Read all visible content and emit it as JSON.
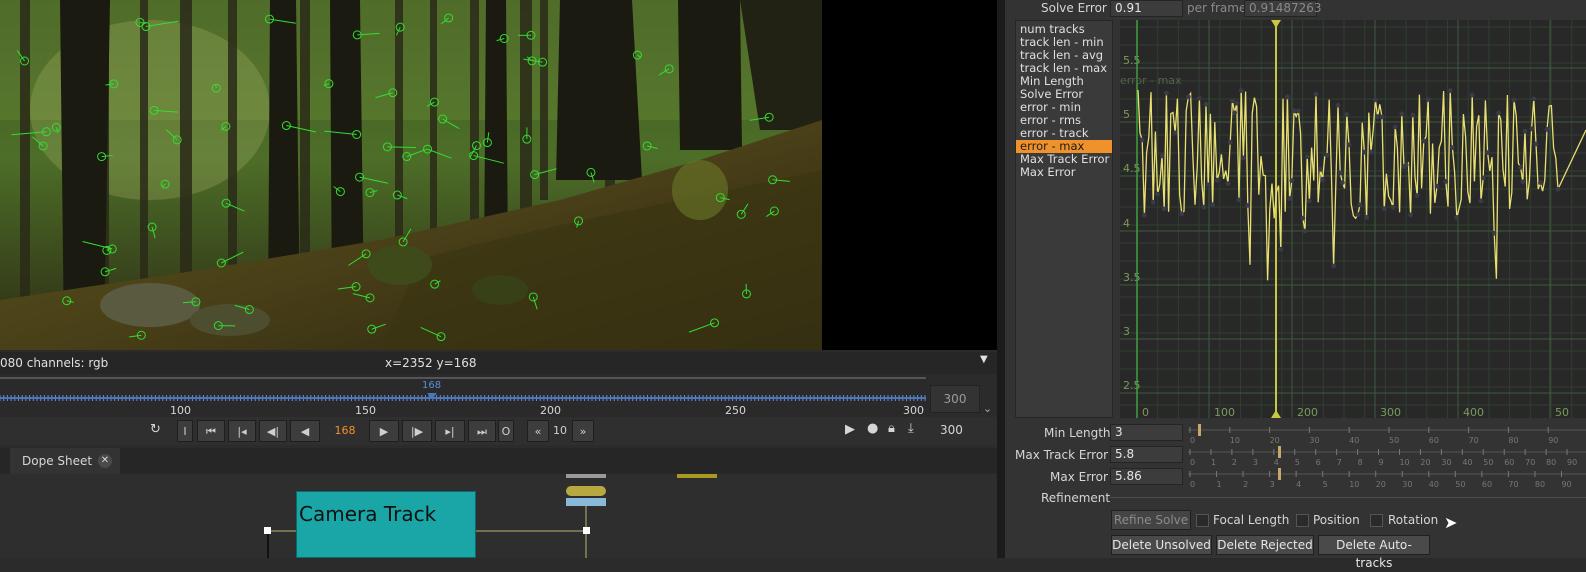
{
  "viewer": {
    "info_format": "080 channels: rgb",
    "coords": "x=2352 y=168"
  },
  "timeline": {
    "current_frame_marker": "168",
    "ticks": [
      "100",
      "150",
      "200",
      "250",
      "300"
    ],
    "end_frame": "300"
  },
  "transport": {
    "frame_field": "168",
    "increment": "10",
    "end_frame": "300",
    "in_label": "I",
    "out_label": "O"
  },
  "dopesheet": {
    "tab_label": "Dope Sheet",
    "node_label": "Camera Track"
  },
  "solve": {
    "error_label": "Solve Error",
    "error_value": "0.91",
    "per_frame_label": "per frame",
    "per_frame_value": "0.91487263"
  },
  "list_items": [
    "num tracks",
    "track len - min",
    "track len - avg",
    "track len - max",
    "Min Length",
    "Solve Error",
    "error - min",
    "error - rms",
    "error - track",
    "error - max",
    "Max Track Error",
    "Max Error"
  ],
  "selected_item": "error - max",
  "graph": {
    "curve_label": "error - max",
    "y_ticks": [
      "5.5",
      "5",
      "4.5",
      "4",
      "3.5",
      "3",
      "2.5"
    ],
    "x_ticks": [
      "0",
      "100",
      "200",
      "300",
      "400",
      "50"
    ],
    "curve_color": "#e8e070",
    "cursor_color": "#c8c840",
    "grid_color": "#3d5a3d"
  },
  "params": {
    "min_length_label": "Min Length",
    "min_length_value": "3",
    "max_track_error_label": "Max Track Error",
    "max_track_error_value": "5.8",
    "max_error_label": "Max Error",
    "max_error_value": "5.86",
    "refinement_label": "Refinement"
  },
  "slider_ticks": {
    "min_length": [
      "0",
      "10",
      "20",
      "30",
      "40",
      "50",
      "60",
      "70",
      "80",
      "90"
    ],
    "max_track_error": [
      "0",
      "1",
      "2",
      "3",
      "4",
      "5",
      "6",
      "7",
      "8",
      "9",
      "10",
      "20",
      "30",
      "40",
      "50",
      "60",
      "70",
      "80",
      "90"
    ],
    "max_error": [
      "0",
      "1",
      "2",
      "3",
      "4",
      "5",
      "10",
      "20",
      "30",
      "40",
      "50",
      "60",
      "70",
      "80",
      "90"
    ]
  },
  "refine": {
    "refine_solve": "Refine Solve",
    "focal_length": "Focal Length",
    "position": "Position",
    "rotation": "Rotation"
  },
  "buttons": {
    "delete_unsolved": "Delete Unsolved",
    "delete_rejected": "Delete Rejected",
    "delete_autotracks": "Delete Auto-tracks"
  },
  "colors": {
    "accent": "#f0922b",
    "node_teal": "#1aa6a6",
    "track_green": "#33dd33"
  }
}
